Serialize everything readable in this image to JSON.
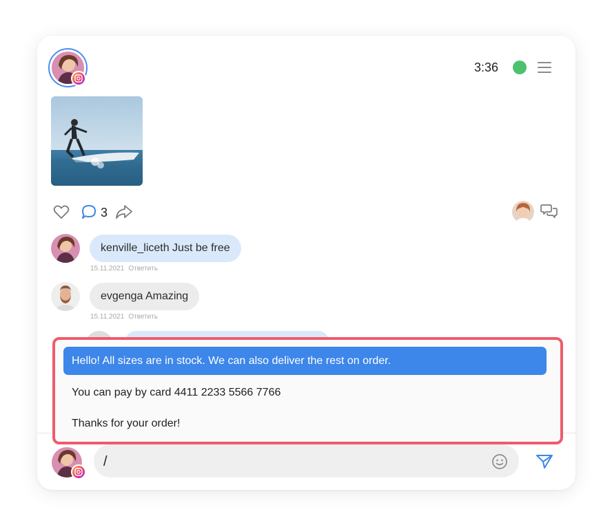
{
  "header": {
    "time": "3:36",
    "status_color": "#4cc26e",
    "account_badge": "instagram-icon"
  },
  "post": {
    "image_alt": "surfer-photo"
  },
  "actions": {
    "comments_count": "3"
  },
  "comments": [
    {
      "text": "kenville_liceth Just be free",
      "date": "15.11.2021",
      "reply_label": "Ответить"
    },
    {
      "text": "evgenga Amazing",
      "date": "15.11.2021",
      "reply_label": "Ответить"
    }
  ],
  "quick_replies": [
    {
      "text": "Hello! All sizes are in stock. We can also deliver the rest on order.",
      "active": true
    },
    {
      "text": "You can pay by card 4411 2233 5566 7766",
      "active": false
    },
    {
      "text": "Thanks for your order!",
      "active": false
    }
  ],
  "composer": {
    "value": "/"
  },
  "colors": {
    "accent": "#3d86ea",
    "highlight_border": "#ee5b6b",
    "bubble_blue": "#d9e9fb",
    "bubble_gray": "#ececec"
  }
}
